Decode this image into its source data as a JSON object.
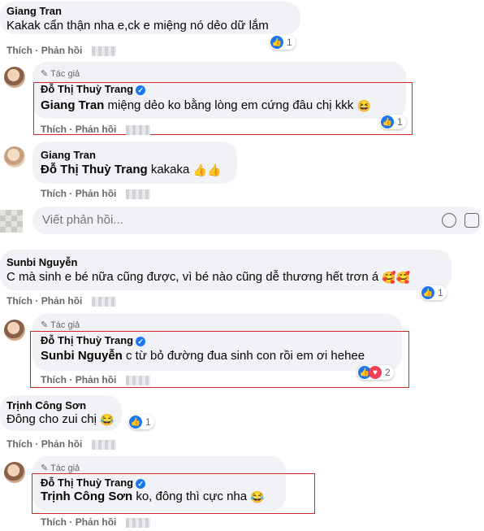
{
  "actions": {
    "like": "Thích",
    "reply": "Phản hồi",
    "dot": "·"
  },
  "author_badge": "Tác giả",
  "comments": [
    {
      "name": "Giang Tran",
      "text": "Kakak cẩn thận nha e,ck e miệng nó dẻo dữ lắm",
      "reactions": "1"
    },
    {
      "name": "Đỗ Thị Thuỳ Trang",
      "tag": "Giang Tran",
      "text": " miệng dẻo ko bằng lòng em cứng đâu chị kkk",
      "emoji": "😆",
      "reactions": "1"
    },
    {
      "name": "Giang Tran",
      "tag": "Đỗ Thị Thuỳ Trang",
      "text": " kakaka",
      "emoji": "👍👍"
    },
    {
      "name": "Sunbi Nguyễn",
      "text": "C mà sinh e bé nữa cũng được, vì bé nào cũng dễ thương hết trơn á",
      "emoji": "🥰🥰",
      "reactions": "1"
    },
    {
      "name": "Đỗ Thị Thuỳ Trang",
      "tag": "Sunbi Nguyễn",
      "text": " c từ bỏ đường đua sinh con rồi em ơi hehee",
      "reactions": "2"
    },
    {
      "name": "Trịnh Công Sơn",
      "text": "Đông cho zui chị",
      "emoji": "😂",
      "reactions": "1"
    },
    {
      "name": "Đỗ Thị Thuỳ Trang",
      "tag": "Trịnh Công Sơn",
      "text": " ko, đông thì cực nha",
      "emoji": "😂"
    }
  ],
  "reply_input": {
    "placeholder": "Viết phản hồi..."
  },
  "colors": {
    "highlight": "#d12a2a",
    "like": "#1877f2",
    "love": "#f33e58",
    "bubble": "#f0f2f5"
  }
}
